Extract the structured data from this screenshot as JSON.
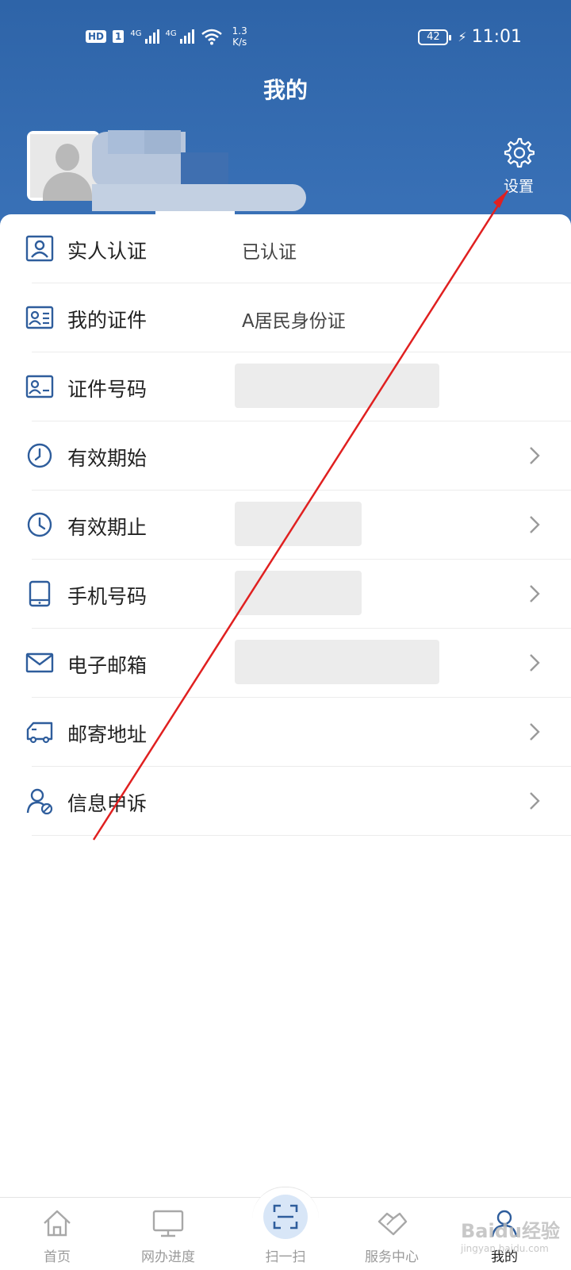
{
  "status_bar": {
    "hd": "HD",
    "sim": "1",
    "network_1": "4G",
    "network_2": "4G",
    "speed_value": "1.3",
    "speed_unit": "K/s",
    "battery": "42",
    "time": "11:01"
  },
  "header": {
    "title": "我的",
    "settings_label": "设置"
  },
  "profile_items": [
    {
      "label": "实人认证",
      "value": "已认证",
      "icon": "person-card-icon",
      "chevron": false
    },
    {
      "label": "我的证件",
      "value": "A居民身份证",
      "icon": "id-card-icon",
      "chevron": false
    },
    {
      "label": "证件号码",
      "value": "",
      "icon": "id-number-icon",
      "chevron": false
    },
    {
      "label": "有效期始",
      "value": "",
      "icon": "clock-icon",
      "chevron": true
    },
    {
      "label": "有效期止",
      "value": "",
      "icon": "clock-icon",
      "chevron": true
    },
    {
      "label": "手机号码",
      "value": "",
      "icon": "phone-icon",
      "chevron": true
    },
    {
      "label": "电子邮箱",
      "value": "",
      "icon": "mail-icon",
      "chevron": true
    },
    {
      "label": "邮寄地址",
      "value": "",
      "icon": "truck-icon",
      "chevron": true
    },
    {
      "label": "信息申诉",
      "value": "",
      "icon": "user-appeal-icon",
      "chevron": true
    }
  ],
  "bottom_nav": [
    {
      "label": "首页",
      "icon": "home-icon",
      "active": false
    },
    {
      "label": "网办进度",
      "icon": "monitor-icon",
      "active": false
    },
    {
      "label": "扫一扫",
      "icon": "scan-icon",
      "active": false
    },
    {
      "label": "服务中心",
      "icon": "handshake-icon",
      "active": false
    },
    {
      "label": "我的",
      "icon": "user-icon",
      "active": true
    }
  ],
  "watermark": {
    "text": "Baidu经验",
    "sub": "jingyan.baidu.com"
  },
  "colors": {
    "header": "#2e64a8",
    "icon": "#2e5d9c",
    "annotation": "#e02020"
  }
}
